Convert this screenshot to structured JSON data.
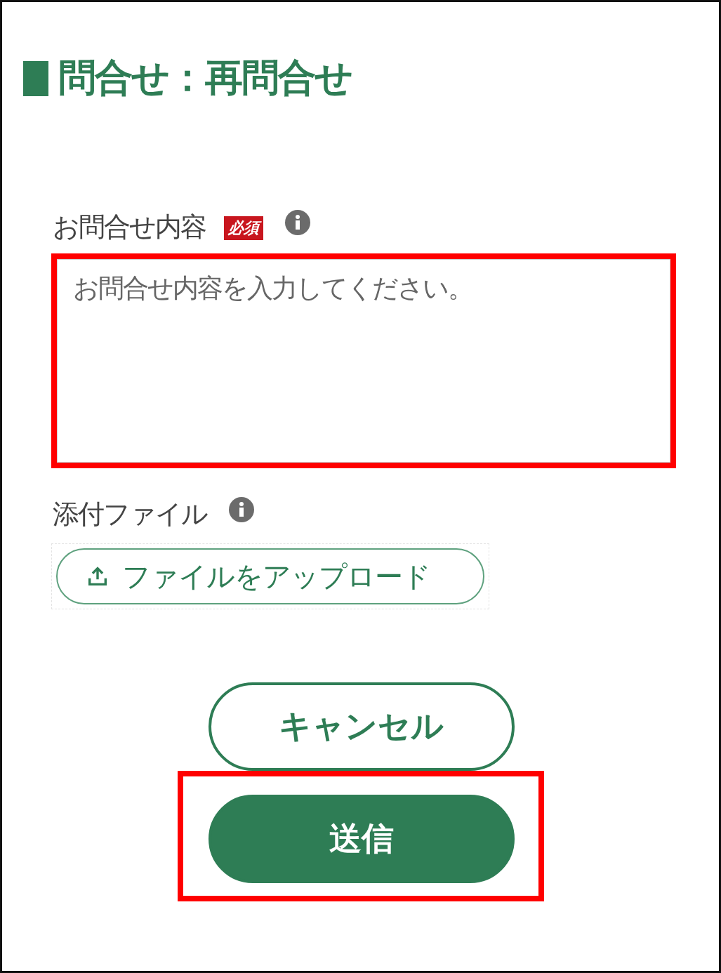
{
  "title": "問合せ：再問合せ",
  "inquiry": {
    "label": "お問合せ内容",
    "required_badge": "必須",
    "info": true,
    "placeholder": "お問合せ内容を入力してください。",
    "highlighted": true
  },
  "attachment": {
    "label": "添付ファイル",
    "info": true,
    "upload_button": "ファイルをアップロード"
  },
  "buttons": [
    {
      "label": "キャンセル",
      "kind": "secondary",
      "highlighted": false
    },
    {
      "label": "送信",
      "kind": "primary",
      "highlighted": true
    }
  ]
}
